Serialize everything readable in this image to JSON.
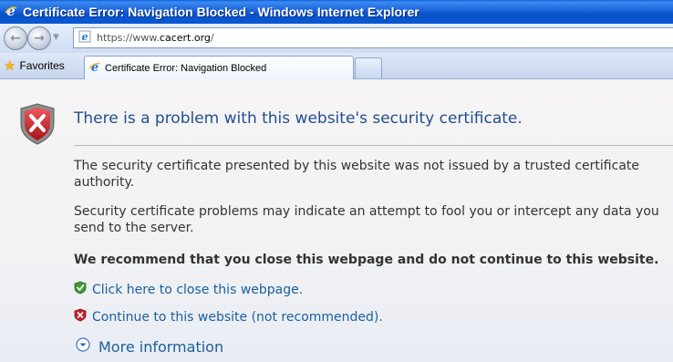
{
  "window": {
    "title": "Certificate Error: Navigation Blocked - Windows Internet Explorer"
  },
  "nav": {
    "address_prefix": "https://www.",
    "address_domain": "cacert.org",
    "address_suffix": "/"
  },
  "tabs": {
    "favorites_label": "Favorites",
    "active_tab_label": "Certificate Error: Navigation Blocked"
  },
  "page": {
    "heading": "There is a problem with this website's security certificate.",
    "paragraph1": "The security certificate presented by this website was not issued by a trusted certificate authority.",
    "paragraph2": "Security certificate problems may indicate an attempt to fool you or intercept any data you send to the server.",
    "recommendation": "We recommend that you close this webpage and do not continue to this website.",
    "close_link": "Click here to close this webpage.",
    "continue_link": "Continue to this website (not recommended).",
    "more_info": "More information"
  },
  "colors": {
    "titlebar": "#0a58d4",
    "heading": "#1f4f8f",
    "link": "#1a5f9e",
    "shield_red": "#c8202a",
    "shield_green": "#3a9a2e"
  },
  "icons": {
    "title": "ie-logo-icon",
    "back": "back-arrow-icon",
    "forward": "forward-arrow-icon",
    "favorites": "star-icon",
    "tab": "ie-page-icon",
    "error": "red-shield-x-icon",
    "close_link": "green-shield-check-icon",
    "continue_link": "red-shield-x-icon",
    "more_info": "chevron-down-circle-icon"
  }
}
